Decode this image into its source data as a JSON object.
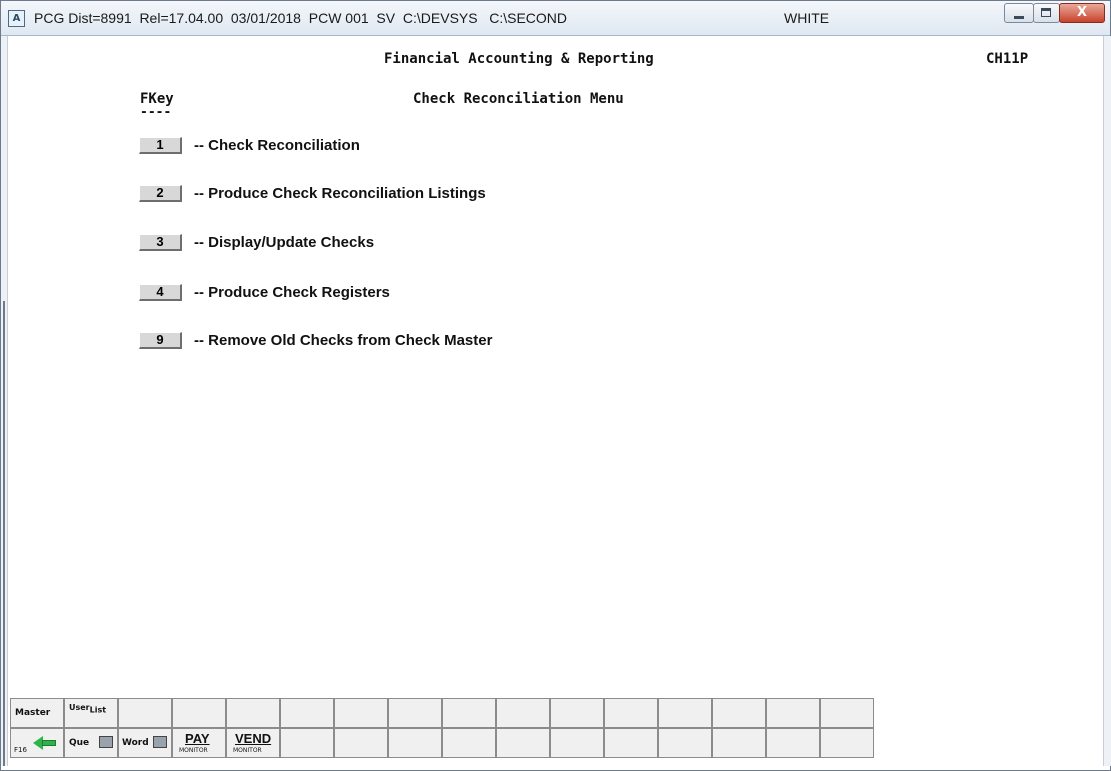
{
  "window": {
    "app_badge": "A",
    "title": "PCG Dist=8991  Rel=17.04.00  03/01/2018  PCW 001  SV  C:\\DEVSYS   C:\\SECOND",
    "user": "WHITE",
    "close_glyph": "X"
  },
  "header": {
    "system_title": "Financial Accounting & Reporting",
    "screen_code": "CH11P"
  },
  "menu": {
    "fkey_label": "FKey",
    "fkey_underline": "----",
    "title": "Check Reconciliation Menu",
    "items": [
      {
        "key": "1",
        "label": "-- Check Reconciliation"
      },
      {
        "key": "2",
        "label": "-- Produce Check Reconciliation Listings"
      },
      {
        "key": "3",
        "label": "-- Display/Update Checks"
      },
      {
        "key": "4",
        "label": "-- Produce Check Registers"
      },
      {
        "key": "9",
        "label": "-- Remove Old Checks from Check Master"
      }
    ]
  },
  "toolbar": {
    "master": "Master",
    "user_list_top": "User",
    "user_list_sub": "List",
    "f16": "F16",
    "que": "Que",
    "word": "Word",
    "pay": "PAY",
    "pay_sub": "MONITOR",
    "vend": "VEND",
    "vend_sub": "MONITOR",
    "icons": {
      "back": "back-arrow-icon",
      "que_print": "print-icon",
      "word_print": "print-icon"
    }
  }
}
